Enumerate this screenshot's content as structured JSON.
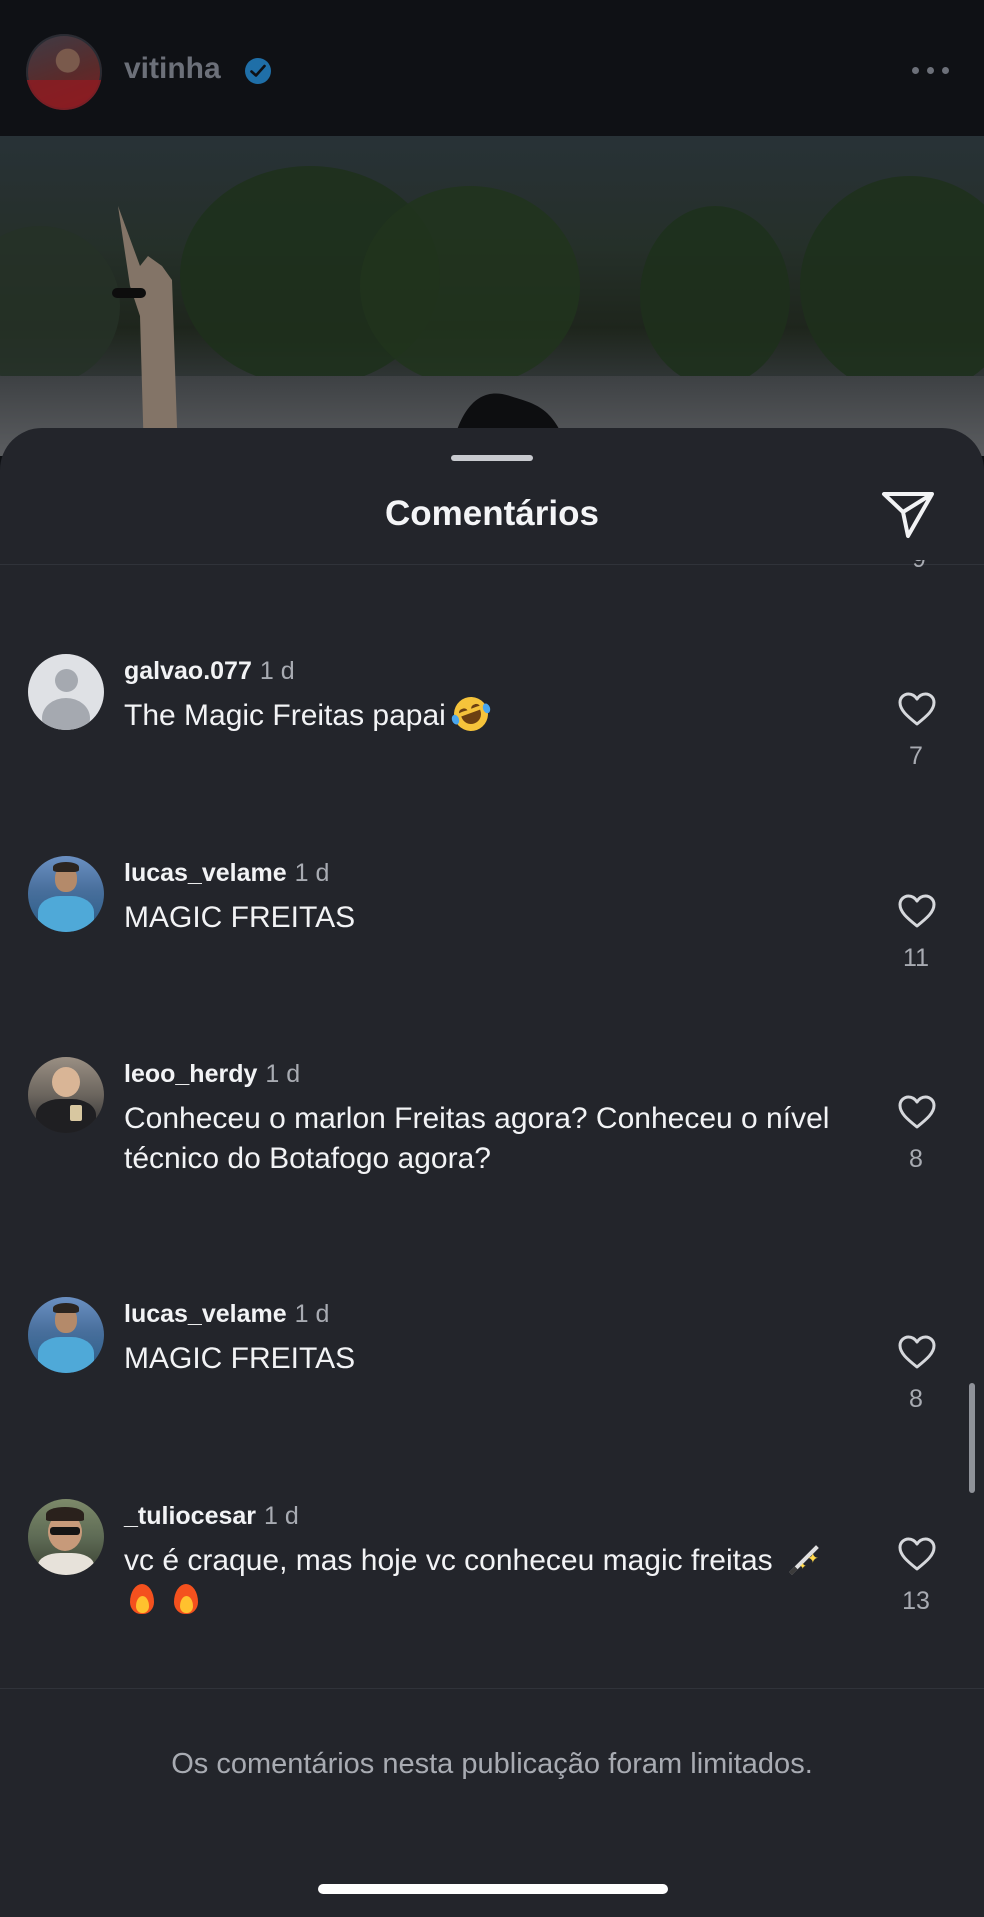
{
  "profile_header": {
    "username": "vitinha",
    "verified_icon": "verified-badge-icon",
    "more_icon": "more-horizontal-icon"
  },
  "comments_sheet": {
    "title": "Comentários",
    "share_icon": "send-icon",
    "peek_like_count": "9",
    "comments": [
      {
        "username": "galvao.077",
        "time": "1 d",
        "text": "The Magic Freitas papai",
        "emoji": [
          "rolling-on-floor-laughing"
        ],
        "likes": "7"
      },
      {
        "username": "lucas_velame",
        "time": "1 d",
        "text": "MAGIC FREITAS",
        "emoji": [],
        "likes": "11"
      },
      {
        "username": "leoo_herdy",
        "time": "1 d",
        "text": "Conheceu o marlon Freitas agora? Conheceu o nível técnico do Botafogo agora?",
        "emoji": [],
        "likes": "8"
      },
      {
        "username": "lucas_velame",
        "time": "1 d",
        "text": "MAGIC FREITAS",
        "emoji": [],
        "likes": "8"
      },
      {
        "username": "_tuliocesar",
        "time": "1 d",
        "text": "vc é craque, mas hoje vc conheceu magic freitas",
        "emoji": [
          "magic-wand",
          "fire",
          "fire"
        ],
        "likes": "13"
      }
    ],
    "limit_notice": "Os comentários nesta publicação foram limitados."
  },
  "colors": {
    "sheet_background": "#23252b",
    "primary_text": "#f2f3f5",
    "secondary_text": "#a8abb2",
    "verified_blue": "#1f6fa8"
  }
}
